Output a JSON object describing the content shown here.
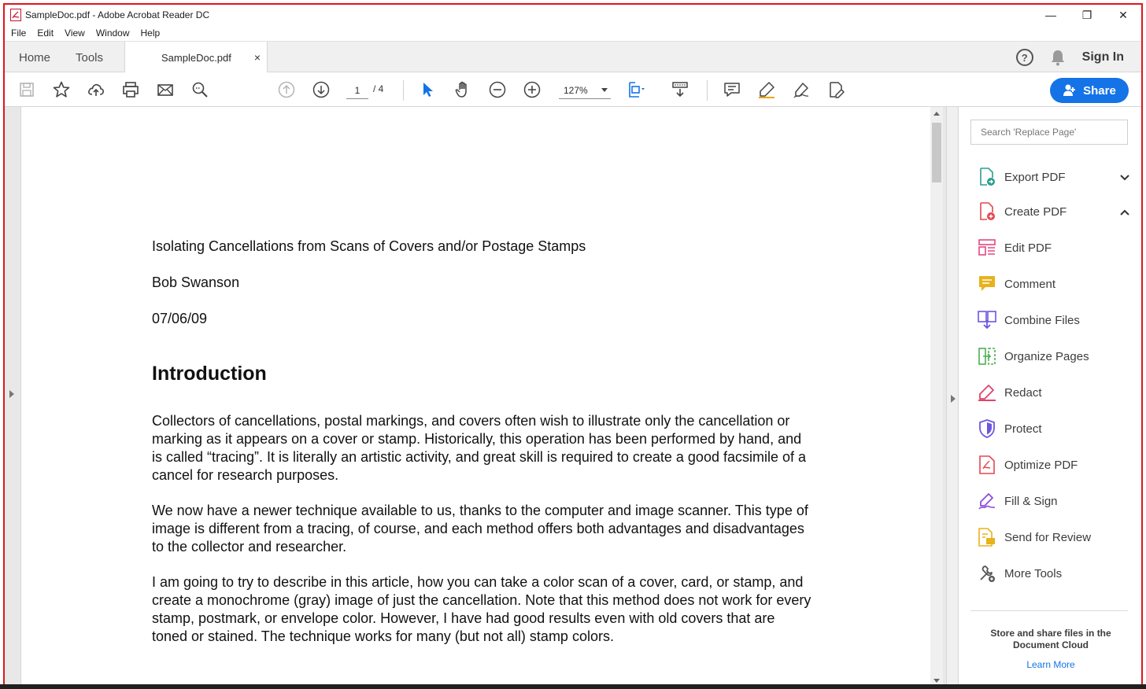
{
  "window": {
    "title": "SampleDoc.pdf - Adobe Acrobat Reader DC",
    "controls": {
      "minimize": "—",
      "restore": "❐",
      "close": "✕"
    }
  },
  "menu": [
    "File",
    "Edit",
    "View",
    "Window",
    "Help"
  ],
  "tabs": {
    "home": "Home",
    "tools": "Tools",
    "document": "SampleDoc.pdf",
    "close": "×",
    "help": "?",
    "signin": "Sign In"
  },
  "toolbar": {
    "page_current": "1",
    "page_total": "/ 4",
    "zoom": "127%",
    "share": "Share",
    "accent_color": "#1473e6"
  },
  "document": {
    "title": "Isolating Cancellations from Scans of Covers and/or Postage Stamps",
    "author": "Bob Swanson",
    "date": "07/06/09",
    "heading": "Introduction",
    "paragraphs": [
      "Collectors of cancellations, postal markings, and covers often wish to illustrate only the cancellation or marking as it appears on a cover or stamp. Historically, this operation has been performed by hand, and is called “tracing”. It is literally an artistic activity, and great skill is required to create a good facsimile of a cancel for research purposes.",
      "We now have a newer technique available to us, thanks to the computer and image scanner. This type of image is different from a tracing, of course, and each method offers both advantages and disadvantages to the collector and researcher.",
      "I am going to try to describe in this article, how you can take a color scan of a cover, card, or stamp, and create a monochrome (gray) image of just the cancellation. Note that this method does not work for every stamp, postmark, or envelope color. However, I have had good results even with old covers that are toned or stained. The technique works for many (but not all) stamp colors."
    ]
  },
  "right_pane": {
    "search_placeholder": "Search 'Replace Page'",
    "tools": [
      {
        "label": "Export PDF",
        "icon": "export-pdf-icon",
        "color": "#2d9d8f"
      },
      {
        "label": "Create PDF",
        "icon": "create-pdf-icon",
        "color": "#e34850"
      },
      {
        "label": "Edit PDF",
        "icon": "edit-pdf-icon",
        "color": "#e34880"
      },
      {
        "label": "Comment",
        "icon": "comment-icon",
        "color": "#e8b21c"
      },
      {
        "label": "Combine Files",
        "icon": "combine-files-icon",
        "color": "#6d57e0"
      },
      {
        "label": "Organize Pages",
        "icon": "organize-pages-icon",
        "color": "#4caf50"
      },
      {
        "label": "Redact",
        "icon": "redact-icon",
        "color": "#e0446c"
      },
      {
        "label": "Protect",
        "icon": "protect-icon",
        "color": "#6d57e0"
      },
      {
        "label": "Optimize PDF",
        "icon": "optimize-pdf-icon",
        "color": "#e34850"
      },
      {
        "label": "Fill & Sign",
        "icon": "fill-sign-icon",
        "color": "#8e4fd6"
      },
      {
        "label": "Send for Review",
        "icon": "send-review-icon",
        "color": "#e8b21c"
      },
      {
        "label": "More Tools",
        "icon": "more-tools-icon",
        "color": "#555555"
      }
    ],
    "cloud_text": "Store and share files in the Document Cloud",
    "learn_more": "Learn More"
  }
}
